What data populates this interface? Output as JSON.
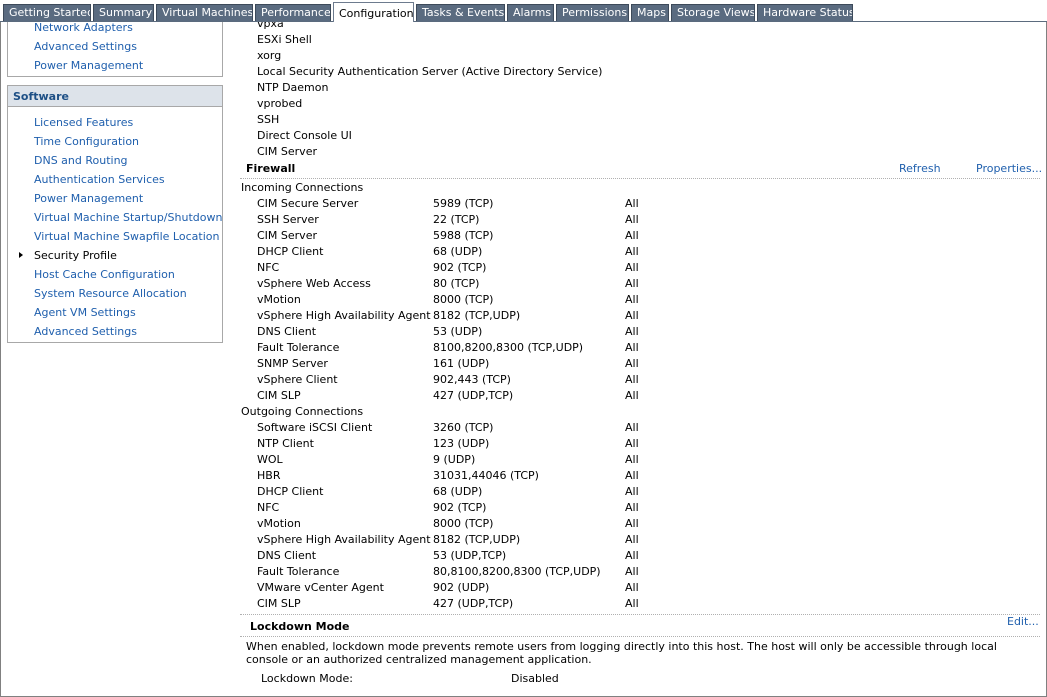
{
  "tabs": [
    "Getting Started",
    "Summary",
    "Virtual Machines",
    "Performance",
    "Configuration",
    "Tasks & Events",
    "Alarms",
    "Permissions",
    "Maps",
    "Storage Views",
    "Hardware Status"
  ],
  "active_tab": "Configuration",
  "hardware_panel": {
    "items": [
      "Network Adapters",
      "Advanced Settings",
      "Power Management"
    ]
  },
  "software_panel": {
    "title": "Software",
    "items": [
      "Licensed Features",
      "Time Configuration",
      "DNS and Routing",
      "Authentication Services",
      "Power Management",
      "Virtual Machine Startup/Shutdown",
      "Virtual Machine Swapfile Location",
      "Security Profile",
      "Host Cache Configuration",
      "System Resource Allocation",
      "Agent VM Settings",
      "Advanced Settings"
    ],
    "selected": "Security Profile"
  },
  "services": [
    "vpxa",
    "ESXi Shell",
    "xorg",
    "Local Security Authentication Server (Active Directory Service)",
    "NTP Daemon",
    "vprobed",
    "SSH",
    "Direct Console UI",
    "CIM Server"
  ],
  "firewall": {
    "title": "Firewall",
    "refresh": "Refresh",
    "properties": "Properties...",
    "incoming_title": "Incoming Connections",
    "incoming": [
      [
        "CIM Secure Server",
        "5989 (TCP)",
        "All"
      ],
      [
        "SSH Server",
        "22 (TCP)",
        "All"
      ],
      [
        "CIM Server",
        "5988 (TCP)",
        "All"
      ],
      [
        "DHCP Client",
        "68 (UDP)",
        "All"
      ],
      [
        "NFC",
        "902 (TCP)",
        "All"
      ],
      [
        "vSphere Web Access",
        "80 (TCP)",
        "All"
      ],
      [
        "vMotion",
        "8000 (TCP)",
        "All"
      ],
      [
        "vSphere High Availability Agent",
        "8182 (TCP,UDP)",
        "All"
      ],
      [
        "DNS Client",
        "53 (UDP)",
        "All"
      ],
      [
        "Fault Tolerance",
        "8100,8200,8300 (TCP,UDP)",
        "All"
      ],
      [
        "SNMP Server",
        "161 (UDP)",
        "All"
      ],
      [
        "vSphere Client",
        "902,443 (TCP)",
        "All"
      ],
      [
        "CIM SLP",
        "427 (UDP,TCP)",
        "All"
      ]
    ],
    "outgoing_title": "Outgoing Connections",
    "outgoing": [
      [
        "Software iSCSI Client",
        "3260 (TCP)",
        "All"
      ],
      [
        "NTP Client",
        "123 (UDP)",
        "All"
      ],
      [
        "WOL",
        "9 (UDP)",
        "All"
      ],
      [
        "HBR",
        "31031,44046 (TCP)",
        "All"
      ],
      [
        "DHCP Client",
        "68 (UDP)",
        "All"
      ],
      [
        "NFC",
        "902 (TCP)",
        "All"
      ],
      [
        "vMotion",
        "8000 (TCP)",
        "All"
      ],
      [
        "vSphere High Availability Agent",
        "8182 (TCP,UDP)",
        "All"
      ],
      [
        "DNS Client",
        "53 (UDP,TCP)",
        "All"
      ],
      [
        "Fault Tolerance",
        "80,8100,8200,8300 (TCP,UDP)",
        "All"
      ],
      [
        "VMware vCenter Agent",
        "902 (UDP)",
        "All"
      ],
      [
        "CIM SLP",
        "427 (UDP,TCP)",
        "All"
      ]
    ]
  },
  "lockdown": {
    "title": "Lockdown Mode",
    "edit": "Edit...",
    "description": "When enabled, lockdown mode prevents remote users from logging directly into this host. The host will only be accessible through local console or an authorized centralized management application.",
    "label": "Lockdown Mode:",
    "value": "Disabled"
  }
}
